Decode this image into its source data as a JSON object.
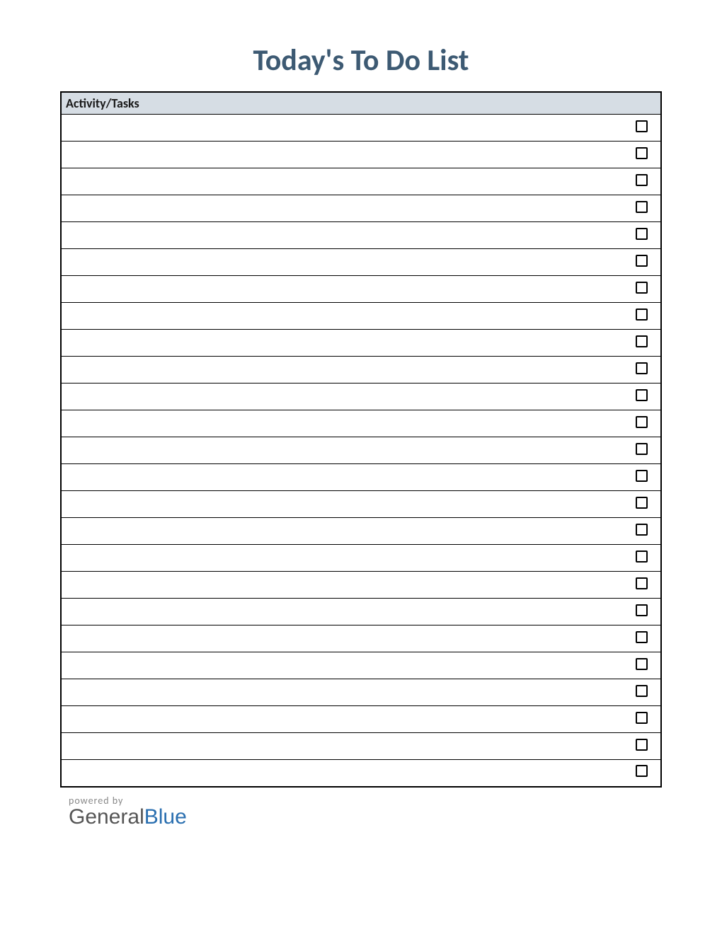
{
  "title": "Today's To Do List",
  "header": "Activity/Tasks",
  "rows": [
    {
      "text": "",
      "checked": false
    },
    {
      "text": "",
      "checked": false
    },
    {
      "text": "",
      "checked": false
    },
    {
      "text": "",
      "checked": false
    },
    {
      "text": "",
      "checked": false
    },
    {
      "text": "",
      "checked": false
    },
    {
      "text": "",
      "checked": false
    },
    {
      "text": "",
      "checked": false
    },
    {
      "text": "",
      "checked": false
    },
    {
      "text": "",
      "checked": false
    },
    {
      "text": "",
      "checked": false
    },
    {
      "text": "",
      "checked": false
    },
    {
      "text": "",
      "checked": false
    },
    {
      "text": "",
      "checked": false
    },
    {
      "text": "",
      "checked": false
    },
    {
      "text": "",
      "checked": false
    },
    {
      "text": "",
      "checked": false
    },
    {
      "text": "",
      "checked": false
    },
    {
      "text": "",
      "checked": false
    },
    {
      "text": "",
      "checked": false
    },
    {
      "text": "",
      "checked": false
    },
    {
      "text": "",
      "checked": false
    },
    {
      "text": "",
      "checked": false
    },
    {
      "text": "",
      "checked": false
    },
    {
      "text": "",
      "checked": false
    }
  ],
  "footer": {
    "powered_by": "powered by",
    "brand_part1": "General",
    "brand_part2": "Blue"
  }
}
